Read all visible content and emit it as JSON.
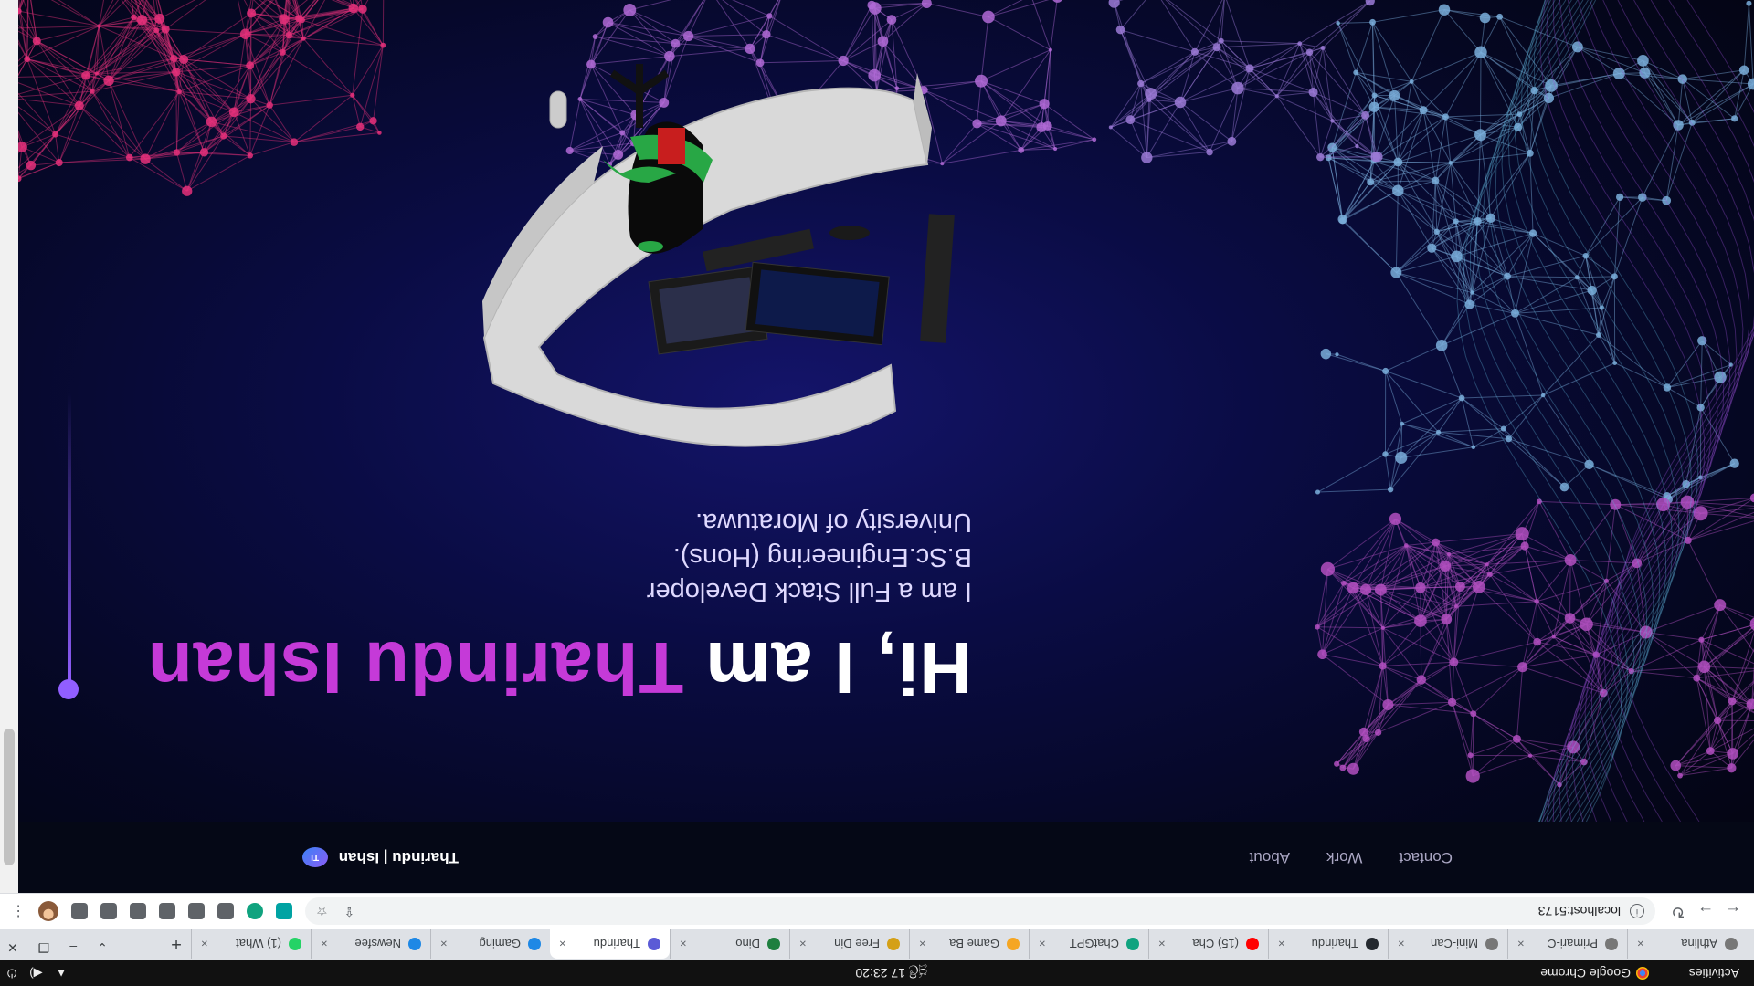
{
  "os": {
    "activities": "Activities",
    "app": "Google Chrome",
    "clock": "ජූලි 17  23:20"
  },
  "tabs": [
    {
      "title": "Athlina",
      "color": "#777"
    },
    {
      "title": "Primari-C",
      "color": "#777"
    },
    {
      "title": "Mini-Can",
      "color": "#777"
    },
    {
      "title": "Tharindu",
      "color": "#24292f"
    },
    {
      "title": "(15) Cha",
      "color": "#ff0000"
    },
    {
      "title": "ChatGPT",
      "color": "#10a37f"
    },
    {
      "title": "Game Ba",
      "color": "#f5a623"
    },
    {
      "title": "Free Din",
      "color": "#d4a017"
    },
    {
      "title": "Dino",
      "color": "#1e7f3f"
    },
    {
      "title": "Tharindu",
      "color": "#5b5bd6",
      "active": true
    },
    {
      "title": "Gaming",
      "color": "#1e88e5"
    },
    {
      "title": "Newsfee",
      "color": "#1e88e5"
    },
    {
      "title": "(1) What",
      "color": "#25d366"
    }
  ],
  "tab_close": "×",
  "new_tab": "+",
  "address": {
    "url": "localhost:5173"
  },
  "site": {
    "logo_initials": "TI",
    "name": "Tharindu | Ishan",
    "nav": [
      "About",
      "Work",
      "Contact"
    ]
  },
  "hero": {
    "greeting": "Hi, I am ",
    "name": "Tharindu Ishan",
    "line1": "I am a Full Stack Developer",
    "line2": "B.Sc.Engineering (Hons).",
    "line3": "University of Moratuwa."
  },
  "colors": {
    "accent": "#915eff",
    "name_highlight": "#c53ad8",
    "background": "#050816"
  }
}
